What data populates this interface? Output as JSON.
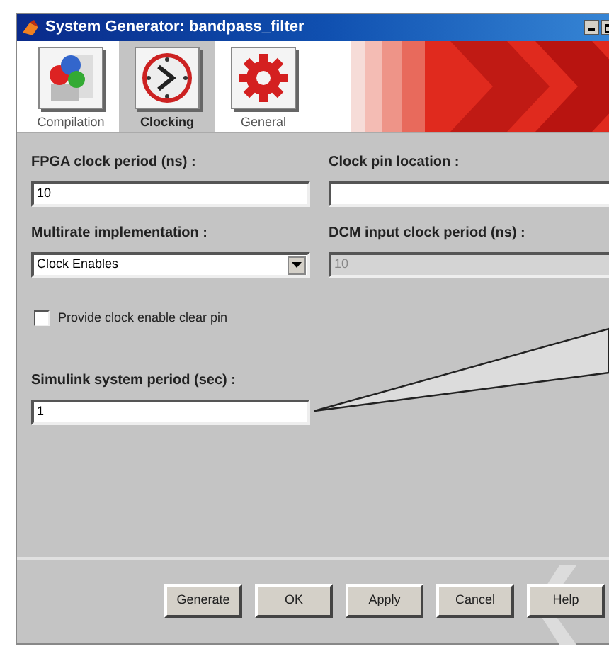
{
  "window": {
    "title": "System Generator: bandpass_filter"
  },
  "tabs": [
    {
      "label": "Compilation",
      "kind": "compilation",
      "selected": false
    },
    {
      "label": "Clocking",
      "kind": "clocking",
      "selected": true
    },
    {
      "label": "General",
      "kind": "general",
      "selected": false
    }
  ],
  "fields": [
    {
      "label": "FPGA clock period (ns) :",
      "kind": "text",
      "value": "10",
      "disabled": false
    },
    {
      "label": "Clock pin location :",
      "kind": "text",
      "disabled": false
    },
    {
      "label": "Multirate implementation :",
      "kind": "combo",
      "value": "Clock Enables",
      "disabled": false
    },
    {
      "label": "DCM input clock period (ns) :",
      "kind": "text",
      "value": "10",
      "disabled": true
    }
  ],
  "checkbox": {
    "label": "Provide clock enable clear pin",
    "checked": false
  },
  "simulink": {
    "label": "Simulink system period (sec) :",
    "value": "1"
  },
  "buttons": [
    "Generate",
    "OK",
    "Apply",
    "Cancel",
    "Help"
  ]
}
